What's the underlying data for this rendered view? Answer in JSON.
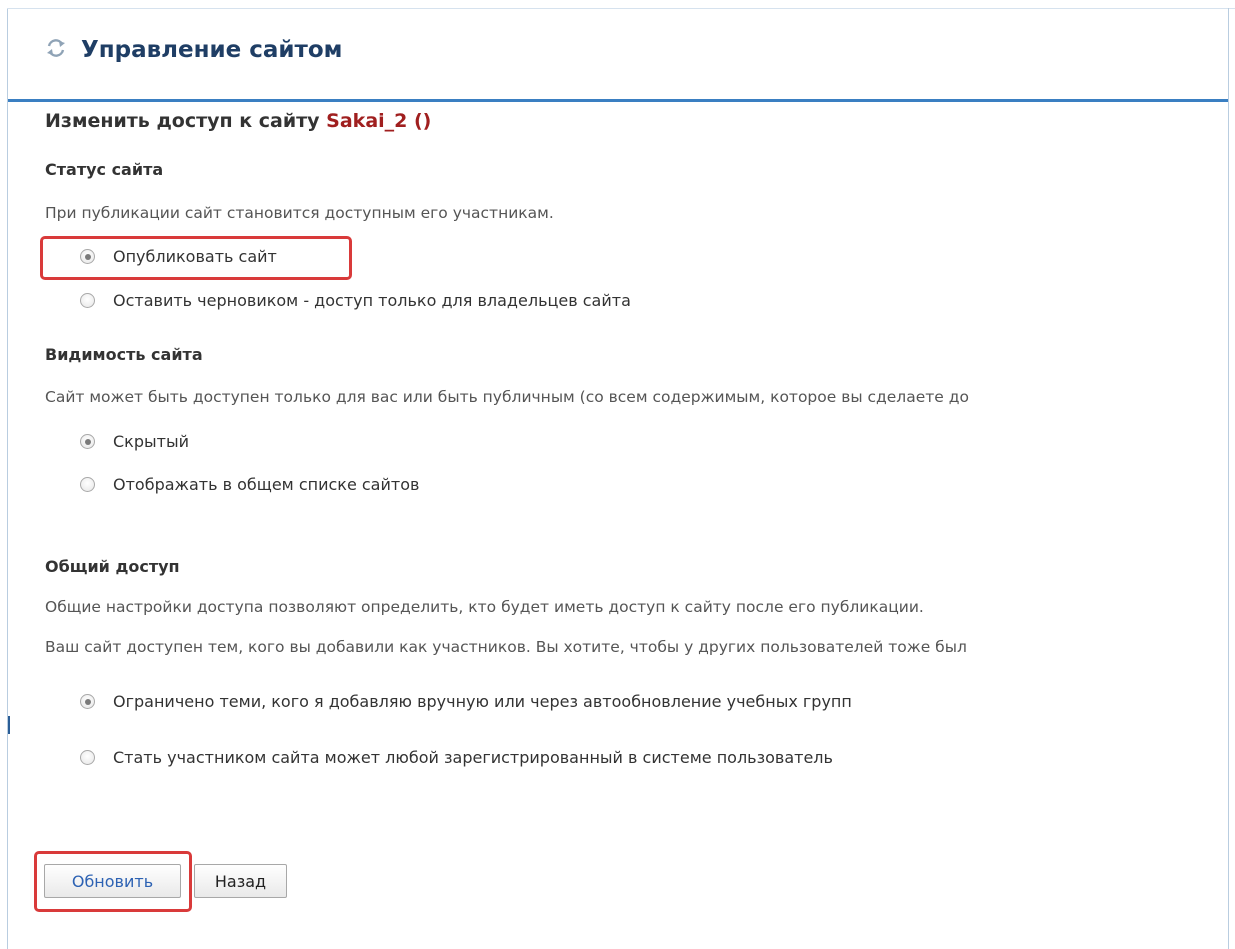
{
  "header": {
    "title": "Управление сайтом",
    "icon": "refresh-arrows-icon"
  },
  "subtitle": {
    "prefix": "Изменить доступ к сайту",
    "site_name": "Sakai_2 ()"
  },
  "status": {
    "heading": "Статус сайта",
    "description": "При публикации сайт становится доступным его участникам.",
    "options": [
      {
        "label": "Опубликовать сайт",
        "checked": true
      },
      {
        "label": "Оставить черновиком - доступ только для владельцев сайта",
        "checked": false
      }
    ]
  },
  "visibility": {
    "heading": "Видимость сайта",
    "description": "Сайт может быть доступен только для вас или быть публичным (со всем содержимым, которое вы сделаете до",
    "options": [
      {
        "label": "Скрытый",
        "checked": true
      },
      {
        "label": "Отображать в общем списке сайтов",
        "checked": false
      }
    ]
  },
  "global_access": {
    "heading": "Общий доступ",
    "description1": "Общие настройки доступа позволяют определить, кто будет иметь доступ к сайту после его публикации.",
    "description2": "Ваш сайт доступен тем, кого вы добавили как участников. Вы хотите, чтобы у других пользователей тоже был",
    "options": [
      {
        "label": "Ограничено теми, кого я добавляю вручную или через автообновление учебных групп",
        "checked": true
      },
      {
        "label": "Стать участником сайта может любой зарегистрированный в системе пользователь",
        "checked": false
      }
    ]
  },
  "buttons": {
    "update_label": "Обновить",
    "back_label": "Назад"
  },
  "colors": {
    "title": "#1f3e65",
    "site_name": "#a01f1f",
    "header_rule": "#3a7fc2",
    "highlight": "#d93a3a",
    "primary_button_text": "#2d62b3"
  }
}
